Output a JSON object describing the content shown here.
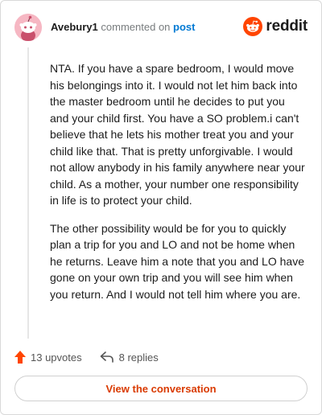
{
  "header": {
    "username": "Avebury1",
    "verb": "commented on",
    "target": "post",
    "brand": "reddit"
  },
  "comment": {
    "paragraphs": [
      "NTA. If you have a spare bedroom, I would move his belongings into it. I would not let him back into the master bedroom until he decides to put you and your child first. You have a SO problem.i can't believe that he lets his mother treat you and your child like that. That is pretty unforgivable. I would not allow anybody in his family anywhere near your child. As a mother, your number one responsibility in life is to protect your child.",
      "The other possibility would be for you to quickly plan a trip for you and LO and not be home when he returns. Leave him a note that you and LO have gone on your own trip and you will see him when you return. And I would not tell him where you are."
    ]
  },
  "actions": {
    "upvotes": "13 upvotes",
    "replies": "8 replies",
    "view_conversation": "View the conversation"
  },
  "colors": {
    "brand_orange": "#ff4500",
    "link_blue": "#0079d3",
    "button_text": "#d93a00"
  },
  "icons": {
    "upvote": "upvote-arrow-icon",
    "reply": "reply-arrow-icon",
    "logo": "reddit-snoo-icon"
  }
}
